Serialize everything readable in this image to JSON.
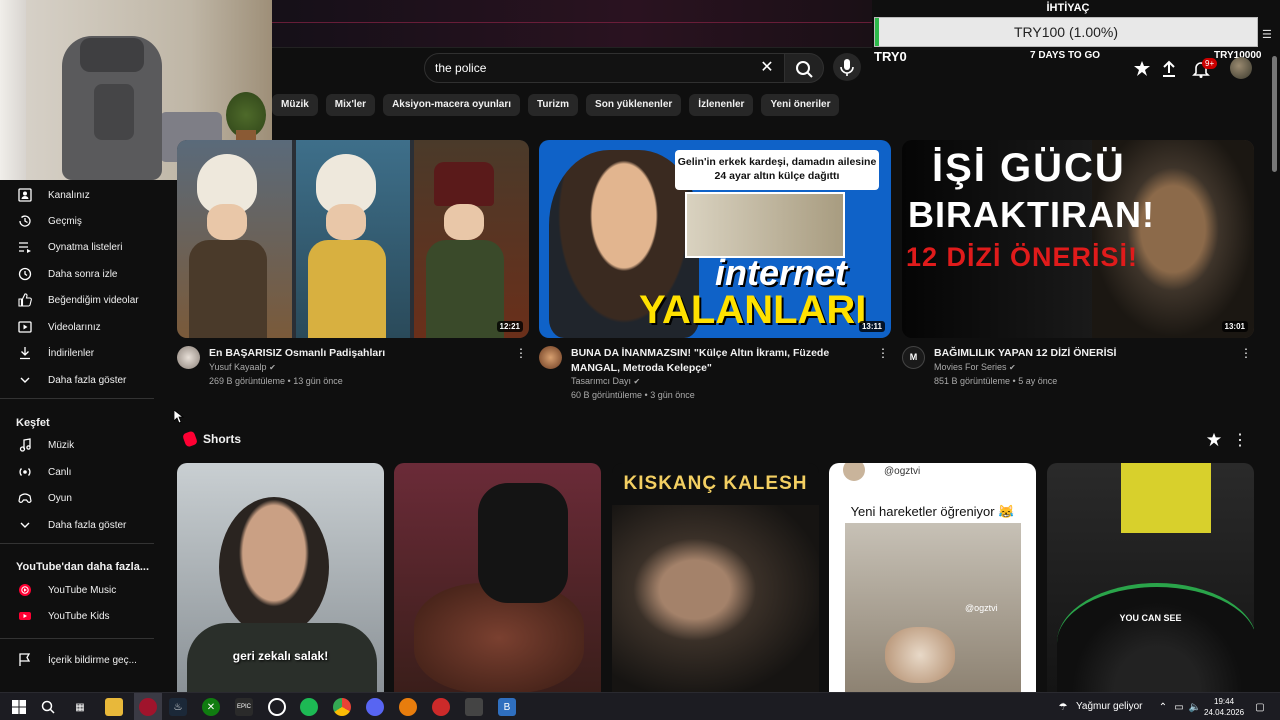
{
  "header": {
    "search_value": "the police"
  },
  "donation": {
    "title": "İHTİYAÇ",
    "progress_text": "TRY100 (1.00%)",
    "progress_fraction": 0.01,
    "min_label": "TRY0",
    "days_label": "7 DAYS TO GO",
    "max_label": "TRY10000"
  },
  "notifications": {
    "badge": "9+"
  },
  "chips": [
    "Müzik",
    "Mix'ler",
    "Aksiyon-macera oyunları",
    "Turizm",
    "Son yüklenenler",
    "İzlenenler",
    "Yeni öneriler"
  ],
  "sidebar": {
    "you_items": [
      {
        "label": "Kanalınız",
        "icon": "user-icon"
      },
      {
        "label": "Geçmiş",
        "icon": "history-icon"
      },
      {
        "label": "Oynatma listeleri",
        "icon": "playlist-icon"
      },
      {
        "label": "Daha sonra izle",
        "icon": "clock-icon"
      },
      {
        "label": "Beğendiğim videolar",
        "icon": "like-icon"
      },
      {
        "label": "Videolarınız",
        "icon": "video-icon"
      },
      {
        "label": "İndirilenler",
        "icon": "download-icon"
      },
      {
        "label": "Daha fazla göster",
        "icon": "chevron-down-icon"
      }
    ],
    "explore_title": "Keşfet",
    "explore_items": [
      {
        "label": "Müzik",
        "icon": "music-icon"
      },
      {
        "label": "Canlı",
        "icon": "live-icon"
      },
      {
        "label": "Oyun",
        "icon": "gaming-icon"
      },
      {
        "label": "Daha fazla göster",
        "icon": "chevron-down-icon"
      }
    ],
    "more_title": "YouTube'dan daha fazla...",
    "more_items": [
      {
        "label": "YouTube Music",
        "icon": "youtube-music-icon"
      },
      {
        "label": "YouTube Kids",
        "icon": "youtube-kids-icon"
      }
    ],
    "report_label": "İçerik bildirme geç..."
  },
  "videos": [
    {
      "title": "En BAŞARISIZ Osmanlı Padişahları",
      "channel": "Yusuf Kayaalp",
      "meta": "269 B görüntüleme • 13 gün önce",
      "duration": "12:21"
    },
    {
      "title": "BUNA DA İNANMAZSIN! \"Külçe Altın İkramı, Füzede MANGAL, Metroda Kelepçe\"",
      "channel": "Tasarımcı Dayı",
      "meta": "60 B görüntüleme • 3 gün önce",
      "duration": "13:11",
      "thumb_box": "Gelin'in erkek kardeşi, damadın ailesine 24 ayar altın külçe dağıttı",
      "thumb_big1": "internet",
      "thumb_big2": "YALANLARI"
    },
    {
      "title": "BAĞIMLILIK YAPAN 12 DİZİ ÖNERİSİ",
      "channel": "Movies For Series",
      "meta": "851 B görüntüleme • 5 ay önce",
      "duration": "13:01",
      "thumb_l1": "İŞİ GÜCÜ",
      "thumb_l2": "BIRAKTIRAN!",
      "thumb_l3": "12 DİZİ ÖNERİSİ!"
    }
  ],
  "shorts": {
    "title": "Shorts",
    "items": [
      {
        "caption": "geri zekalı salak!"
      },
      {
        "caption": ""
      },
      {
        "caption": "KISKANÇ KALESH"
      },
      {
        "handle": "@ogztvi",
        "caption": "Yeni hareketler öğreniyor 😹",
        "watermark": "@ogztvi"
      },
      {
        "caption": "YOU CAN SEE"
      }
    ]
  },
  "taskbar": {
    "weather": "Yağmur geliyor",
    "time": "19:44",
    "date": "24.04.2026"
  }
}
